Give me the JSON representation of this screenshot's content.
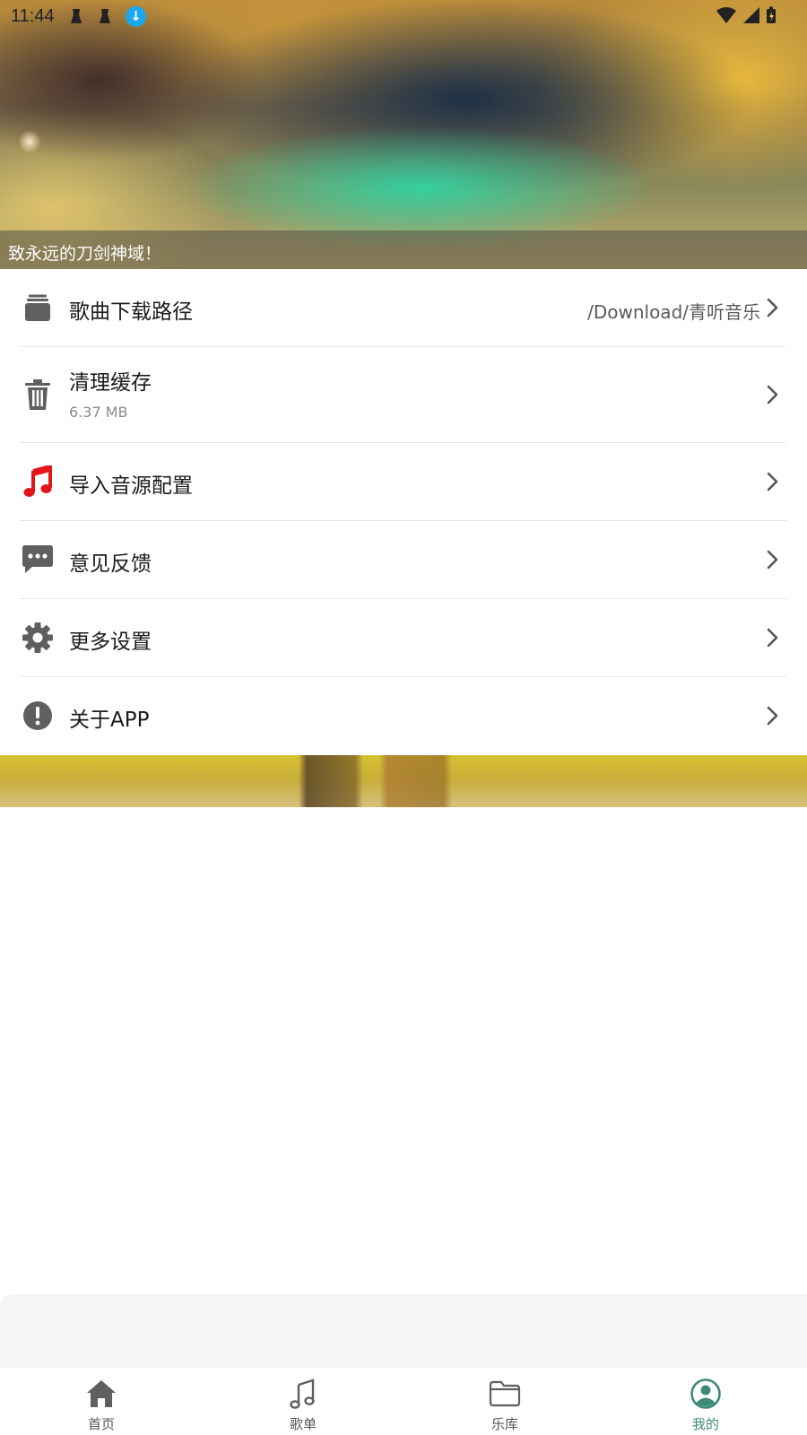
{
  "status_bar": {
    "time": "11:44",
    "download_glyph": "↓"
  },
  "banner": {
    "caption": "致永远的刀剑神域！"
  },
  "settings": [
    {
      "id": "download-path",
      "icon": "folder-stack-icon",
      "label": "歌曲下载路径",
      "value": "/Download/青听音乐"
    },
    {
      "id": "clear-cache",
      "icon": "trash-icon",
      "label": "清理缓存",
      "sub": "6.37 MB"
    },
    {
      "id": "import-source",
      "icon": "music-note-icon",
      "label": "导入音源配置",
      "icon_color": "#e3151a"
    },
    {
      "id": "feedback",
      "icon": "chat-bubble-icon",
      "label": "意见反馈"
    },
    {
      "id": "more-settings",
      "icon": "gear-icon",
      "label": "更多设置"
    },
    {
      "id": "about-app",
      "icon": "info-alert-icon",
      "label": "关于APP"
    }
  ],
  "bottom_nav": [
    {
      "id": "home",
      "icon": "home-icon",
      "label": "首页",
      "active": false
    },
    {
      "id": "playlist",
      "icon": "music-note-icon",
      "label": "歌单",
      "active": false
    },
    {
      "id": "library",
      "icon": "folder-icon",
      "label": "乐库",
      "active": false
    },
    {
      "id": "mine",
      "icon": "user-circle-icon",
      "label": "我的",
      "active": true
    }
  ],
  "colors": {
    "accent": "#3e8a76",
    "icon_gray": "#5f5f5f",
    "music_red": "#e3151a",
    "status_blue": "#1aa7ee"
  }
}
